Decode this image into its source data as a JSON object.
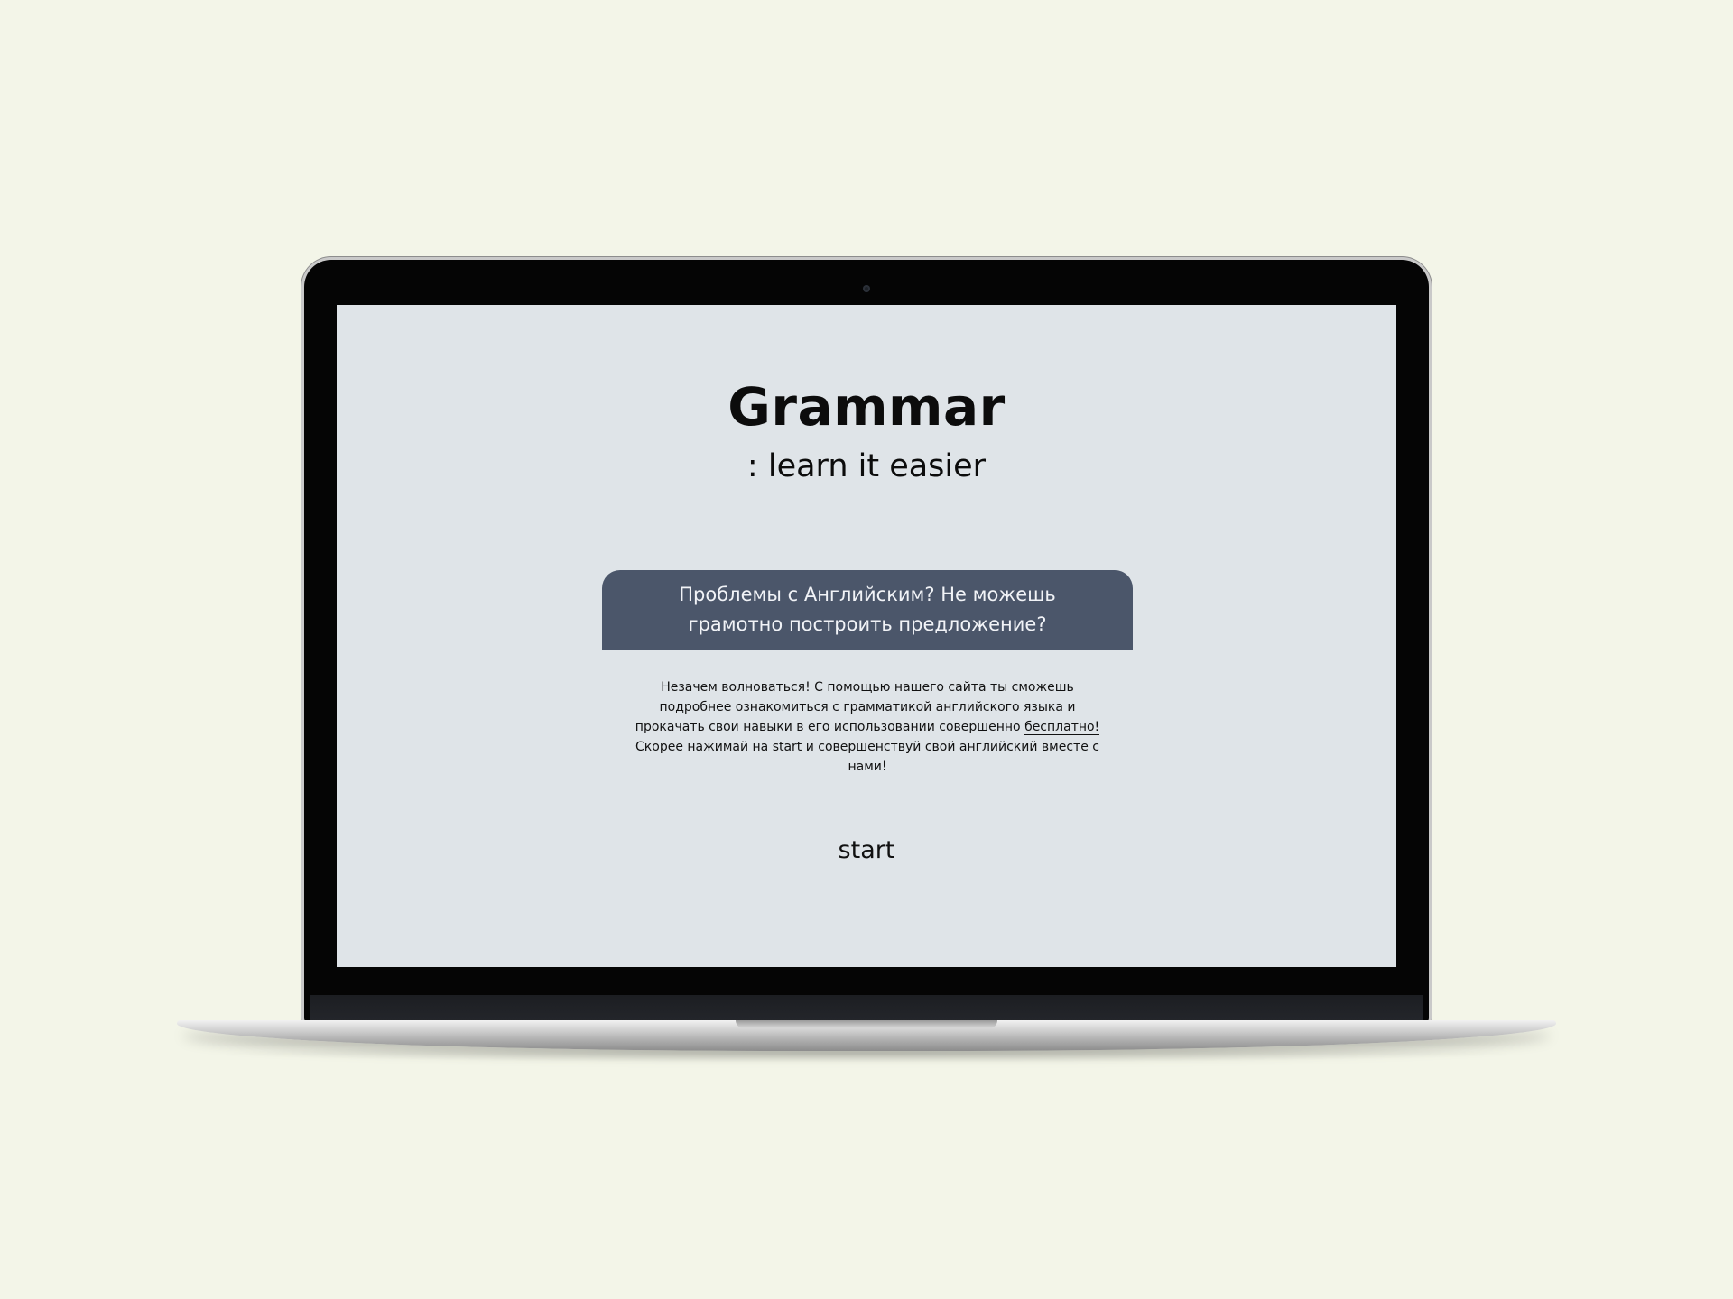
{
  "page": {
    "title": "Grammar",
    "subtitle": ": learn it easier",
    "question": "Проблемы с Английским? Не можешь грамотно построить предложение?",
    "description_before": "Незачем волноваться! С помощью нашего сайта ты сможешь подробнее ознакомиться с грамматикой английского языка и прокачать свои навыки в его использовании совершенно ",
    "free_link": "бесплатно!",
    "description_after": " Скорее нажимай на start и совершенствуй свой английский вместе с нами!",
    "start_label": "start"
  },
  "colors": {
    "background": "#f3f5e8",
    "screen": "#dfe4e8",
    "question_box": "#4b566a",
    "question_text": "#f1f3f7",
    "text": "#111111"
  }
}
